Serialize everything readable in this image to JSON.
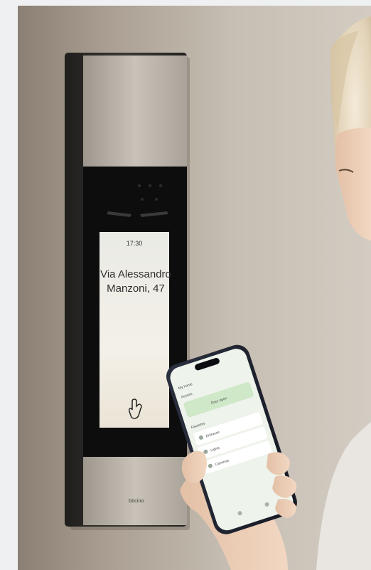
{
  "intercom": {
    "time": "17:30",
    "address_line1": "Via Alessandro",
    "address_line2": "Manzoni, 47",
    "brand": "bticino"
  },
  "phone_app": {
    "home_title": "My home",
    "section_label": "Access",
    "highlight_label": "Door open",
    "list_header": "Favorites",
    "items": [
      "Entrance",
      "Lights",
      "Cameras"
    ]
  },
  "colors": {
    "wall": "#bdb4a9",
    "intercom_frame": "#2c2b29",
    "intercom_panel": "#b8b2a8",
    "screen": "#f0ede6",
    "phone_screen": "#eef3ec",
    "accent_green": "#cfe8c8"
  }
}
